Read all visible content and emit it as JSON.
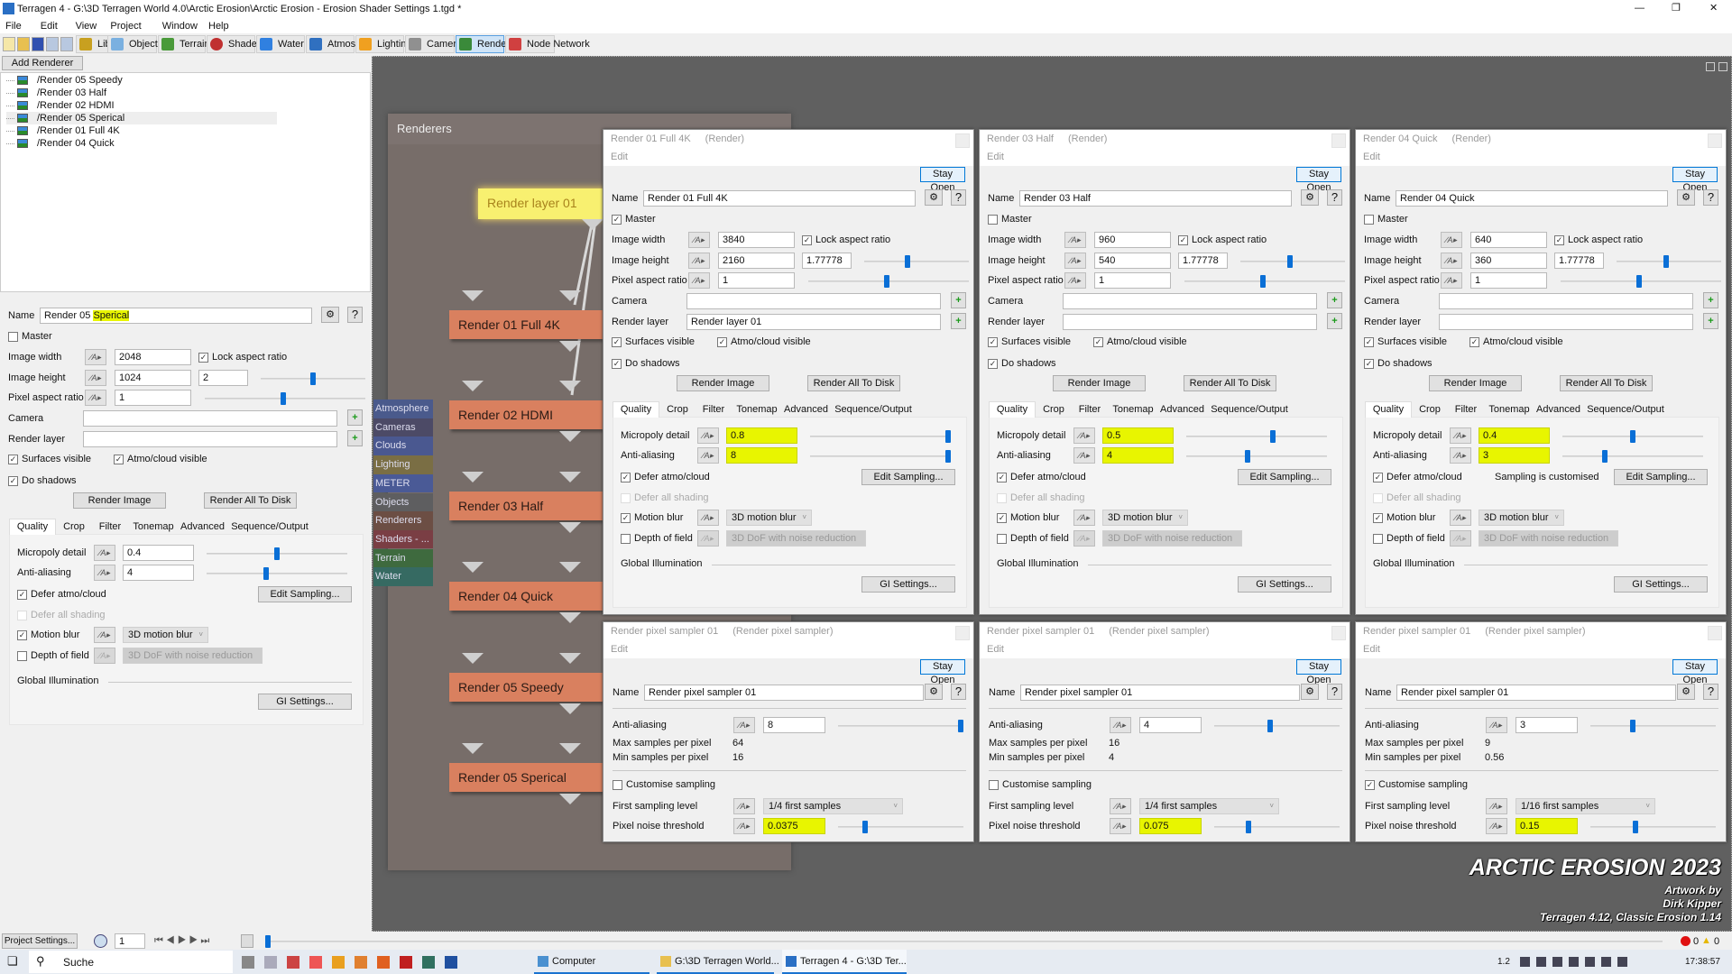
{
  "window": {
    "title": "Terragen 4 - G:\\3D Terragen World 4.0\\Arctic Erosion\\Arctic Erosion - Erosion Shader Settings 1.tgd *"
  },
  "menu": [
    "File",
    "Edit",
    "View",
    "Project",
    "Window",
    "Help"
  ],
  "toolbar": {
    "tabs": [
      {
        "label": "Library",
        "icon": "library-icon"
      },
      {
        "label": "Objects",
        "icon": "objects-icon"
      },
      {
        "label": "Terrain",
        "icon": "terrain-icon"
      },
      {
        "label": "Shaders",
        "icon": "shaders-icon"
      },
      {
        "label": "Water",
        "icon": "water-icon"
      },
      {
        "label": "Atmosphere",
        "icon": "atmosphere-icon"
      },
      {
        "label": "Lighting",
        "icon": "lighting-icon"
      },
      {
        "label": "Cameras",
        "icon": "cameras-icon"
      },
      {
        "label": "Renderers",
        "icon": "renderers-icon",
        "active": true
      },
      {
        "label": "Node Network",
        "icon": "node-network-icon"
      }
    ]
  },
  "tree": {
    "add_button": "Add Renderer",
    "items": [
      "/Render 05 Speedy",
      "/Render 03 Half",
      "/Render 02 HDMI",
      "/Render 05 Sperical",
      "/Render 01 Full 4K",
      "/Render 04 Quick"
    ]
  },
  "labels": {
    "name": "Name",
    "master": "Master",
    "image_width": "Image width",
    "image_height": "Image height",
    "pixel_aspect": "Pixel aspect ratio",
    "camera": "Camera",
    "render_layer": "Render layer",
    "surfaces": "Surfaces visible",
    "atmo": "Atmo/cloud visible",
    "shadows": "Do shadows",
    "render_image": "Render Image",
    "render_all": "Render All To Disk",
    "lock": "Lock aspect ratio",
    "tabs": [
      "Quality",
      "Crop",
      "Filter",
      "Tonemap",
      "Advanced",
      "Sequence/Output"
    ],
    "micropoly": "Micropoly detail",
    "aa": "Anti-aliasing",
    "defer_atmo": "Defer atmo/cloud",
    "defer_all": "Defer all shading",
    "edit_sampling": "Edit Sampling...",
    "motion_blur": "Motion blur",
    "dof": "Depth of field",
    "motion_blur_value": "3D motion blur",
    "dof_value": "3D DoF with noise reduction",
    "gi": "Global Illumination",
    "gi_settings": "GI Settings...",
    "edit": "Edit",
    "stay_open": "Stay Open",
    "max_samples": "Max samples per pixel",
    "min_samples": "Min samples per pixel",
    "customise": "Customise sampling",
    "first_level": "First sampling level",
    "noise_threshold": "Pixel noise threshold"
  },
  "left_panel": {
    "name_parts": [
      "Render 05 ",
      "Sperical"
    ],
    "master": false,
    "width": "2048",
    "height": "1024",
    "ratio": "2",
    "pixel_aspect": "1",
    "camera": "",
    "render_layer": "",
    "surfaces": true,
    "atmo": true,
    "shadows": true,
    "lock": true,
    "micropoly": "0.4",
    "aa": "4",
    "highlight": false,
    "sampling_note": "",
    "defer_atmo": true,
    "motion_blur": true,
    "dof": false,
    "slider_ratio": 0.5,
    "slider_pixel": 0.49,
    "slider_micropoly": 0.5,
    "slider_aa": 0.42
  },
  "render_panels": [
    {
      "title": "Render 01 Full 4K",
      "kind": "(Render)",
      "name": "Render 01 Full 4K",
      "master": true,
      "width": "3840",
      "height": "2160",
      "ratio": "1.77778",
      "pixel_aspect": "1",
      "camera": "",
      "render_layer": "Render layer 01",
      "surfaces": true,
      "atmo": true,
      "shadows": true,
      "lock": true,
      "micropoly": "0.8",
      "aa": "8",
      "highlight": true,
      "sampling_note": "",
      "defer_atmo": true,
      "motion_blur": true,
      "dof": false,
      "slider_ratio": 0.41,
      "slider_pixel": 0.49,
      "slider_micropoly": 1.0,
      "slider_aa": 1.0
    },
    {
      "title": "Render 03 Half",
      "kind": "(Render)",
      "name": "Render 03 Half",
      "master": false,
      "width": "960",
      "height": "540",
      "ratio": "1.77778",
      "pixel_aspect": "1",
      "camera": "",
      "render_layer": "",
      "surfaces": true,
      "atmo": true,
      "shadows": true,
      "lock": true,
      "micropoly": "0.5",
      "aa": "4",
      "highlight": true,
      "sampling_note": "",
      "defer_atmo": true,
      "motion_blur": true,
      "dof": false,
      "slider_ratio": 0.47,
      "slider_pixel": 0.49,
      "slider_micropoly": 0.62,
      "slider_aa": 0.43
    },
    {
      "title": "Render 04 Quick",
      "kind": "(Render)",
      "name": "Render 04 Quick",
      "master": false,
      "width": "640",
      "height": "360",
      "ratio": "1.77778",
      "pixel_aspect": "1",
      "camera": "",
      "render_layer": "",
      "surfaces": true,
      "atmo": true,
      "shadows": true,
      "lock": true,
      "micropoly": "0.4",
      "aa": "3",
      "highlight": true,
      "sampling_note": "Sampling is customised",
      "defer_atmo": true,
      "motion_blur": true,
      "dof": false,
      "slider_ratio": 0.47,
      "slider_pixel": 0.49,
      "slider_micropoly": 0.5,
      "slider_aa": 0.29
    }
  ],
  "sampler_panels": [
    {
      "title": "Render pixel sampler 01",
      "kind": "(Render pixel sampler)",
      "name": "Render pixel sampler 01",
      "aa": "8",
      "max": "64",
      "min": "16",
      "customise": false,
      "first_level": "1/4 first samples",
      "threshold": "0.0375",
      "slider_aa": 1.0,
      "slider_threshold": 0.2
    },
    {
      "title": "Render pixel sampler 01",
      "kind": "(Render pixel sampler)",
      "name": "Render pixel sampler 01",
      "aa": "4",
      "max": "16",
      "min": "4",
      "customise": false,
      "first_level": "1/4 first samples",
      "threshold": "0.075",
      "slider_aa": 0.44,
      "slider_threshold": 0.26
    },
    {
      "title": "Render pixel sampler 01",
      "kind": "(Render pixel sampler)",
      "name": "Render pixel sampler 01",
      "aa": "3",
      "max": "9",
      "min": "0.56",
      "customise": true,
      "first_level": "1/16 first samples",
      "threshold": "0.15",
      "slider_aa": 0.33,
      "slider_threshold": 0.35
    }
  ],
  "node_graph": {
    "title": "Renderers",
    "layer_node": "Render layer 01",
    "nodes": [
      "Render 01 Full 4K",
      "Render 02 HDMI",
      "Render 03 Half",
      "Render 04 Quick",
      "Render 05 Speedy",
      "Render 05 Sperical"
    ],
    "side_tabs": [
      {
        "label": "Atmosphere",
        "color": "#4a5a8c"
      },
      {
        "label": "Cameras",
        "color": "#4c4a66"
      },
      {
        "label": "Clouds",
        "color": "#4a5890"
      },
      {
        "label": "Lighting",
        "color": "#7a6e44"
      },
      {
        "label": "METER",
        "color": "#4a5a96"
      },
      {
        "label": "Objects",
        "color": "#5e5e60"
      },
      {
        "label": "Renderers",
        "color": "#6c4e44"
      },
      {
        "label": "Shaders - ...",
        "color": "#7a3e44"
      },
      {
        "label": "Terrain",
        "color": "#3e6a3e"
      },
      {
        "label": "Water",
        "color": "#366a62"
      }
    ]
  },
  "watermark": {
    "title": "ARCTIC EROSION 2023",
    "line1": "Artwork by",
    "line2": "Dirk Kipper",
    "line3": "Terragen 4.12, Classic Erosion 1.14"
  },
  "status": {
    "project_settings": "Project Settings...",
    "frame": "1",
    "errors": "0",
    "warnings": "0"
  },
  "taskbar": {
    "search": "Suche",
    "apps": [
      "Computer",
      "G:\\3D Terragen World...",
      "Terragen 4 - G:\\3D Ter..."
    ],
    "tray_text": "1.2",
    "clock": "17:38:57"
  },
  "colors": {
    "highlight": "#e8f500",
    "node": "#d9805f",
    "layer_node": "#f8f070",
    "accent": "#0078d7"
  }
}
